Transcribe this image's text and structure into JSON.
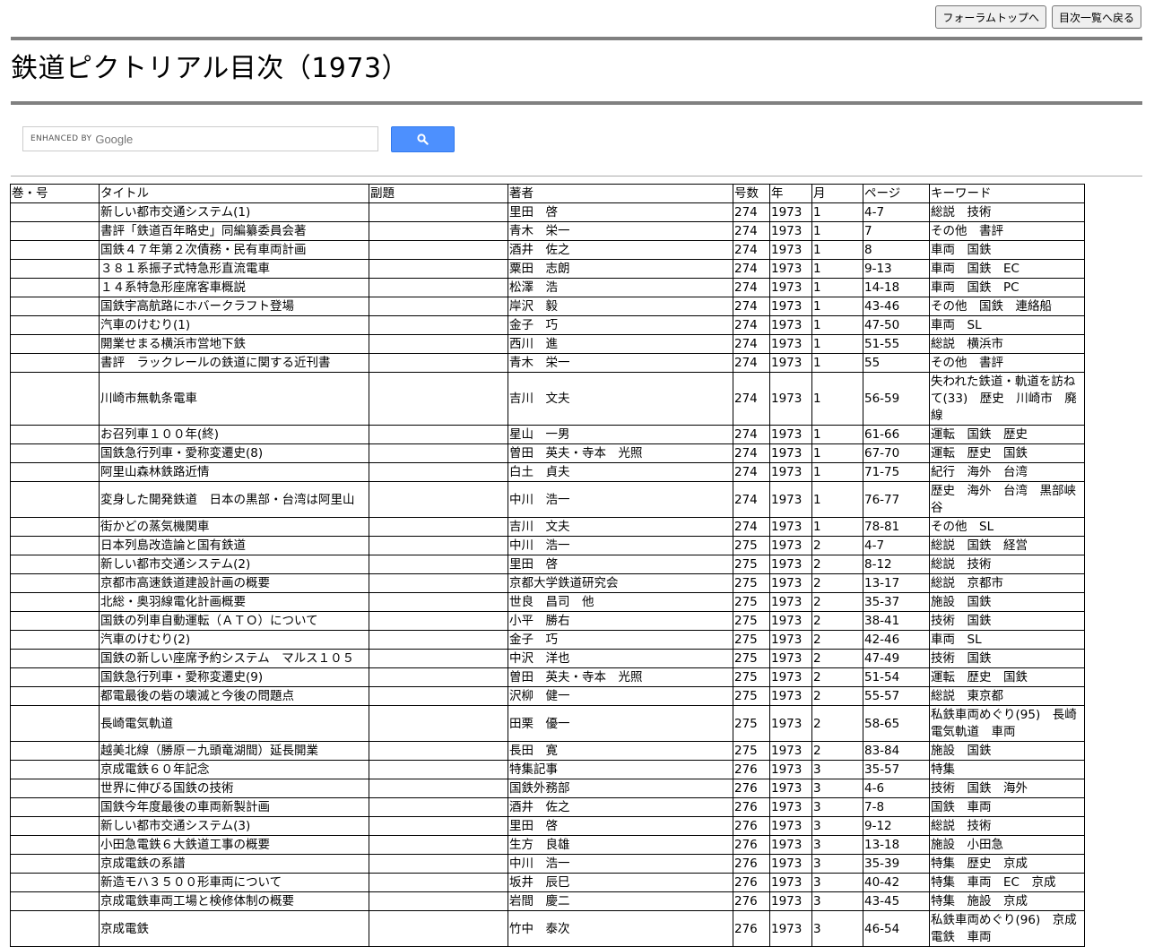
{
  "nav": {
    "forum_top": "フォーラムトップへ",
    "toc_list": "目次一覧へ戻る"
  },
  "page_title": "鉄道ピクトリアル目次（1973）",
  "search": {
    "enhanced_by": "ENHANCED BY",
    "google": "Google",
    "icon": "search-icon",
    "button_color": "#4d90fe"
  },
  "table": {
    "headers": [
      "巻・号",
      "タイトル",
      "副題",
      "著者",
      "号数",
      "年",
      "月",
      "ページ",
      "キーワード"
    ],
    "rows": [
      [
        "",
        "新しい都市交通システム(1)",
        "",
        "里田　啓",
        "274",
        "1973",
        "1",
        "4-7",
        "総説　技術"
      ],
      [
        "",
        "書評「鉄道百年略史」同編纂委員会著",
        "",
        "青木　栄一",
        "274",
        "1973",
        "1",
        "7",
        "その他　書評"
      ],
      [
        "",
        "国鉄４７年第２次債務・民有車両計画",
        "",
        "酒井　佐之",
        "274",
        "1973",
        "1",
        "8",
        "車両　国鉄"
      ],
      [
        "",
        "３８１系振子式特急形直流電車",
        "",
        "粟田　志朗",
        "274",
        "1973",
        "1",
        "9-13",
        "車両　国鉄　EC"
      ],
      [
        "",
        "１４系特急形座席客車概説",
        "",
        "松澤　浩",
        "274",
        "1973",
        "1",
        "14-18",
        "車両　国鉄　PC"
      ],
      [
        "",
        "国鉄宇高航路にホバークラフト登場",
        "",
        "岸沢　毅",
        "274",
        "1973",
        "1",
        "43-46",
        "その他　国鉄　連絡船"
      ],
      [
        "",
        "汽車のけむり(1)",
        "",
        "金子　巧",
        "274",
        "1973",
        "1",
        "47-50",
        "車両　SL"
      ],
      [
        "",
        "開業せまる横浜市営地下鉄",
        "",
        "西川　進",
        "274",
        "1973",
        "1",
        "51-55",
        "総説　横浜市"
      ],
      [
        "",
        "書評　ラックレールの鉄道に関する近刊書",
        "",
        "青木　栄一",
        "274",
        "1973",
        "1",
        "55",
        "その他　書評"
      ],
      [
        "",
        "川崎市無軌条電車",
        "",
        "吉川　文夫",
        "274",
        "1973",
        "1",
        "56-59",
        "失われた鉄道・軌道を訪ねて(33)　歴史　川崎市　廃線"
      ],
      [
        "",
        "お召列車１００年(終)",
        "",
        "星山　一男",
        "274",
        "1973",
        "1",
        "61-66",
        "運転　国鉄　歴史"
      ],
      [
        "",
        "国鉄急行列車・愛称変遷史(8)",
        "",
        "曽田　英夫・寺本　光照",
        "274",
        "1973",
        "1",
        "67-70",
        "運転　歴史　国鉄"
      ],
      [
        "",
        "阿里山森林鉄路近情",
        "",
        "白土　貞夫",
        "274",
        "1973",
        "1",
        "71-75",
        "紀行　海外　台湾"
      ],
      [
        "",
        "変身した開発鉄道　日本の黒部・台湾は阿里山",
        "",
        "中川　浩一",
        "274",
        "1973",
        "1",
        "76-77",
        "歴史　海外　台湾　黒部峡谷"
      ],
      [
        "",
        "街かどの蒸気機関車",
        "",
        "吉川　文夫",
        "274",
        "1973",
        "1",
        "78-81",
        "その他　SL"
      ],
      [
        "",
        "日本列島改造論と国有鉄道",
        "",
        "中川　浩一",
        "275",
        "1973",
        "2",
        "4-7",
        "総説　国鉄　経営"
      ],
      [
        "",
        "新しい都市交通システム(2)",
        "",
        "里田　啓",
        "275",
        "1973",
        "2",
        "8-12",
        "総説　技術"
      ],
      [
        "",
        "京都市高速鉄道建設計画の概要",
        "",
        "京都大学鉄道研究会",
        "275",
        "1973",
        "2",
        "13-17",
        "総説　京都市"
      ],
      [
        "",
        "北総・奥羽線電化計画概要",
        "",
        "世良　昌司　他",
        "275",
        "1973",
        "2",
        "35-37",
        "施設　国鉄"
      ],
      [
        "",
        "国鉄の列車自動運転（ＡＴＯ）について",
        "",
        "小平　勝右",
        "275",
        "1973",
        "2",
        "38-41",
        "技術　国鉄"
      ],
      [
        "",
        "汽車のけむり(2)",
        "",
        "金子　巧",
        "275",
        "1973",
        "2",
        "42-46",
        "車両　SL"
      ],
      [
        "",
        "国鉄の新しい座席予約システム　マルス１０５",
        "",
        "中沢　洋也",
        "275",
        "1973",
        "2",
        "47-49",
        "技術　国鉄"
      ],
      [
        "",
        "国鉄急行列車・愛称変遷史(9)",
        "",
        "曽田　英夫・寺本　光照",
        "275",
        "1973",
        "2",
        "51-54",
        "運転　歴史　国鉄"
      ],
      [
        "",
        "都電最後の砦の壊滅と今後の問題点",
        "",
        "沢柳　健一",
        "275",
        "1973",
        "2",
        "55-57",
        "総説　東京都"
      ],
      [
        "",
        "長崎電気軌道",
        "",
        "田栗　優一",
        "275",
        "1973",
        "2",
        "58-65",
        "私鉄車両めぐり(95)　長崎電気軌道　車両"
      ],
      [
        "",
        "越美北線（勝原－九頭竜湖間）延長開業",
        "",
        "長田　寛",
        "275",
        "1973",
        "2",
        "83-84",
        "施設　国鉄"
      ],
      [
        "",
        "京成電鉄６０年記念",
        "",
        "特集記事",
        "276",
        "1973",
        "3",
        "35-57",
        "特集"
      ],
      [
        "",
        "世界に伸びる国鉄の技術",
        "",
        "国鉄外務部",
        "276",
        "1973",
        "3",
        "4-6",
        "技術　国鉄　海外"
      ],
      [
        "",
        "国鉄今年度最後の車両新製計画",
        "",
        "酒井　佐之",
        "276",
        "1973",
        "3",
        "7-8",
        "国鉄　車両"
      ],
      [
        "",
        "新しい都市交通システム(3)",
        "",
        "里田　啓",
        "276",
        "1973",
        "3",
        "9-12",
        "総説　技術"
      ],
      [
        "",
        "小田急電鉄６大鉄道工事の概要",
        "",
        "生方　良雄",
        "276",
        "1973",
        "3",
        "13-18",
        "施設　小田急"
      ],
      [
        "",
        "京成電鉄の系譜",
        "",
        "中川　浩一",
        "276",
        "1973",
        "3",
        "35-39",
        "特集　歴史　京成"
      ],
      [
        "",
        "新造モハ３５００形車両について",
        "",
        "坂井　辰巳",
        "276",
        "1973",
        "3",
        "40-42",
        "特集　車両　EC　京成"
      ],
      [
        "",
        "京成電鉄車両工場と検修体制の概要",
        "",
        "岩間　慶二",
        "276",
        "1973",
        "3",
        "43-45",
        "特集　施設　京成"
      ],
      [
        "",
        "京成電鉄",
        "",
        "竹中　泰次",
        "276",
        "1973",
        "3",
        "46-54",
        "私鉄車両めぐり(96)　京成電鉄　車両"
      ]
    ]
  }
}
